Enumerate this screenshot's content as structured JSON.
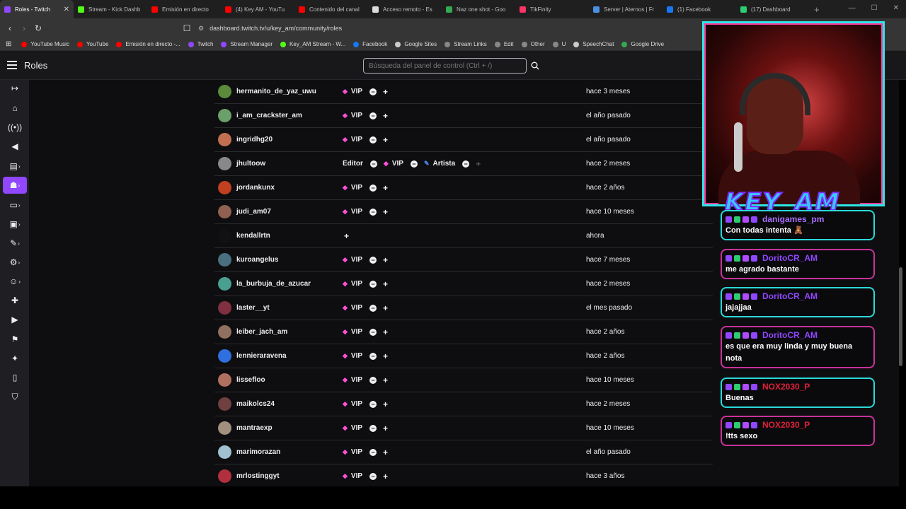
{
  "browser": {
    "tabs": [
      {
        "label": "Roles - Twitch",
        "color": "#9147ff",
        "active": true
      },
      {
        "label": "Stream - Kick Dashb",
        "color": "#53fc18"
      },
      {
        "label": "Emisión en directo",
        "color": "#ff0000"
      },
      {
        "label": "(4) Key AM - YouTu",
        "color": "#ff0000"
      },
      {
        "label": "Contenido del canal",
        "color": "#ff0000"
      },
      {
        "label": "Acceso remoto - Es",
        "color": "#dddddd"
      },
      {
        "label": "Naz one shot - Goo",
        "color": "#34a853"
      },
      {
        "label": "TikFinity",
        "color": "#ff3366"
      },
      {
        "label": "Server | Aternos | Fr",
        "color": "#4a90e2"
      },
      {
        "label": "(1) Facebook",
        "color": "#1877f2"
      },
      {
        "label": "(17) Dashboard",
        "color": "#2ecc71"
      }
    ],
    "url": "dashboard.twitch.tv/u/key_am/community/roles",
    "bookmarks": [
      {
        "label": "YouTube Music",
        "color": "#ff0000"
      },
      {
        "label": "YouTube",
        "color": "#ff0000"
      },
      {
        "label": "Emisión en directo -...",
        "color": "#ff0000"
      },
      {
        "label": "Twitch",
        "color": "#9147ff"
      },
      {
        "label": "Stream Manager",
        "color": "#9147ff"
      },
      {
        "label": "Key_AM Stream - W...",
        "color": "#53fc18"
      },
      {
        "label": "Facebook",
        "color": "#1877f2"
      },
      {
        "label": "Google Sites",
        "color": "#cccccc"
      },
      {
        "label": "Stream Links",
        "color": "#888888"
      },
      {
        "label": "Edit",
        "color": "#888888"
      },
      {
        "label": "Other",
        "color": "#888888"
      },
      {
        "label": "U",
        "color": "#888888"
      },
      {
        "label": "SpeechChat",
        "color": "#cccccc"
      },
      {
        "label": "Google Drive",
        "color": "#34a853"
      }
    ]
  },
  "header": {
    "title": "Roles",
    "search_placeholder": "Búsqueda del panel de control (Ctrl + /)"
  },
  "roles_table": {
    "rows": [
      {
        "user": "hermanito_de_yaz_uwu",
        "date": "hace 3 meses",
        "avatar": "#5a8a3a",
        "vip": true
      },
      {
        "user": "i_am_crackster_am",
        "date": "el año pasado",
        "avatar": "#6aa06a",
        "vip": true
      },
      {
        "user": "ingridhg20",
        "date": "el año pasado",
        "avatar": "#c07050",
        "vip": true
      },
      {
        "user": "jhultoow",
        "date": "hace 2 meses",
        "avatar": "#888888",
        "vip": true,
        "editor": "Editor",
        "artist": "Artista"
      },
      {
        "user": "jordankunx",
        "date": "hace 2 años",
        "avatar": "#c04020",
        "vip": true
      },
      {
        "user": "judi_am07",
        "date": "hace 10 meses",
        "avatar": "#906050",
        "vip": true
      },
      {
        "user": "kendallrtn",
        "date": "ahora",
        "avatar": "#111111",
        "vip": false
      },
      {
        "user": "kuroangelus",
        "date": "hace 7 meses",
        "avatar": "#4a7080",
        "vip": true
      },
      {
        "user": "la_burbuja_de_azucar",
        "date": "hace 2 meses",
        "avatar": "#4aa090",
        "vip": true
      },
      {
        "user": "laster__yt",
        "date": "el mes pasado",
        "avatar": "#803040",
        "vip": true
      },
      {
        "user": "leiber_jach_am",
        "date": "hace 2 años",
        "avatar": "#907060",
        "vip": true
      },
      {
        "user": "lennieraravena",
        "date": "hace 2 años",
        "avatar": "#2f6fe0",
        "vip": true
      },
      {
        "user": "lissefloo",
        "date": "hace 10 meses",
        "avatar": "#b07060",
        "vip": true
      },
      {
        "user": "maikolcs24",
        "date": "hace 2 meses",
        "avatar": "#704040",
        "vip": true
      },
      {
        "user": "mantraexp",
        "date": "hace 10 meses",
        "avatar": "#a09080",
        "vip": true
      },
      {
        "user": "marimorazan",
        "date": "el año pasado",
        "avatar": "#a0c0d0",
        "vip": true
      },
      {
        "user": "mrlostinggyt",
        "date": "hace 3 años",
        "avatar": "#b03040",
        "vip": true
      }
    ],
    "vip_label": "VIP"
  },
  "overlay": {
    "logo_text": "KEY_AM",
    "chat": [
      {
        "user": "danigames_pm",
        "text": "Con todas intenta 🧸",
        "user_color": "#a970ff",
        "border": "cyan"
      },
      {
        "user": "DoritoCR_AM",
        "text": "me agrado bastante",
        "user_color": "#9147ff",
        "border": "pink"
      },
      {
        "user": "DoritoCR_AM",
        "text": "jajajjaa",
        "user_color": "#9147ff",
        "border": "cyan"
      },
      {
        "user": "DoritoCR_AM",
        "text": "es que era muy linda y muy buena nota",
        "user_color": "#9147ff",
        "border": "pink"
      },
      {
        "user": "NOX2030_P",
        "text": "Buenas",
        "user_color": "#e0203a",
        "border": "cyan"
      },
      {
        "user": "NOX2030_P",
        "text": "!tts sexo",
        "user_color": "#e0203a",
        "border": "pink"
      }
    ]
  }
}
